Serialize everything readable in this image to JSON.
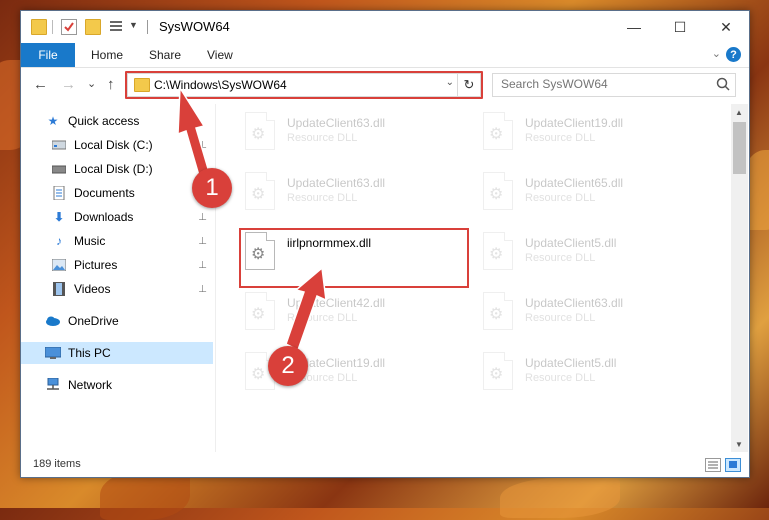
{
  "window": {
    "title": "SysWOW64",
    "minimize_glyph": "—",
    "maximize_glyph": "☐",
    "close_glyph": "✕"
  },
  "ribbon": {
    "file": "File",
    "tabs": [
      "Home",
      "Share",
      "View"
    ],
    "help_glyph": "?",
    "expand_glyph": "⌄"
  },
  "nav": {
    "back_glyph": "←",
    "forward_glyph": "→",
    "recent_glyph": "⌄",
    "up_glyph": "↑",
    "address": "C:\\Windows\\SysWOW64",
    "address_chevron": "⌄",
    "refresh_glyph": "↻",
    "search_placeholder": "Search SysWOW64"
  },
  "sidebar": {
    "items": [
      {
        "label": "Quick access",
        "icon": "star-icon",
        "pinned": false
      },
      {
        "label": "Local Disk (C:)",
        "icon": "drive-icon",
        "pinned": true
      },
      {
        "label": "Local Disk (D:)",
        "icon": "drive-icon",
        "pinned": false
      },
      {
        "label": "Documents",
        "icon": "document-icon",
        "pinned": true
      },
      {
        "label": "Downloads",
        "icon": "download-icon",
        "pinned": true
      },
      {
        "label": "Music",
        "icon": "music-icon",
        "pinned": true
      },
      {
        "label": "Pictures",
        "icon": "pictures-icon",
        "pinned": true
      },
      {
        "label": "Videos",
        "icon": "video-icon",
        "pinned": true
      },
      {
        "label": "OneDrive",
        "icon": "cloud-icon",
        "pinned": false
      },
      {
        "label": "This PC",
        "icon": "computer-icon",
        "pinned": false,
        "selected": true
      },
      {
        "label": "Network",
        "icon": "network-icon",
        "pinned": false
      }
    ],
    "pin_glyph": "📌"
  },
  "files": [
    {
      "name": "UpdateClient63.dll",
      "type": "Resource DLL",
      "faded": true
    },
    {
      "name": "UpdateClient19.dll",
      "type": "Resource DLL",
      "faded": true
    },
    {
      "name": "UpdateClient63.dll",
      "type": "Resource DLL",
      "faded": true
    },
    {
      "name": "UpdateClient65.dll",
      "type": "Resource DLL",
      "faded": true
    },
    {
      "name": "iirlpnormmex.dll",
      "type": "",
      "faded": false
    },
    {
      "name": "UpdateClient5.dll",
      "type": "Resource DLL",
      "faded": true
    },
    {
      "name": "UpdateClient42.dll",
      "type": "Resource DLL",
      "faded": true
    },
    {
      "name": "UpdateClient63.dll",
      "type": "Resource DLL",
      "faded": true
    },
    {
      "name": "UpdateClient19.dll",
      "type": "Resource DLL",
      "faded": true
    },
    {
      "name": "UpdateClient5.dll",
      "type": "Resource DLL",
      "faded": true
    }
  ],
  "status": {
    "count": "189 items"
  },
  "annotations": {
    "step1": "1",
    "step2": "2",
    "color": "#d9403a"
  }
}
